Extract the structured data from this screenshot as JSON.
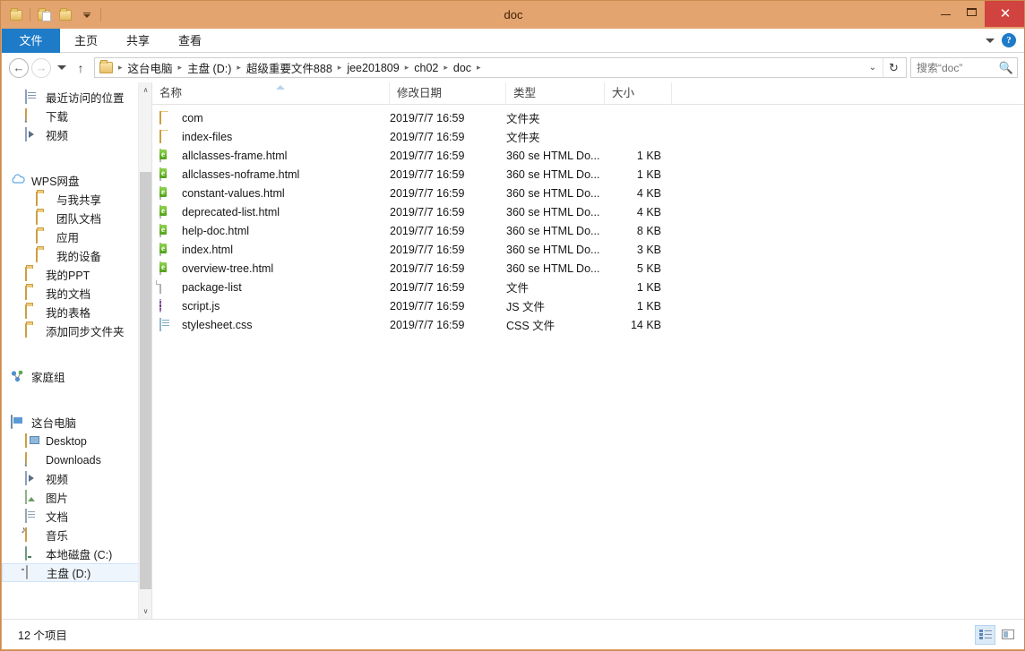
{
  "window": {
    "title": "doc",
    "quick_access": [
      "folder-icon",
      "properties-icon",
      "new-folder-icon",
      "customize-dropdown"
    ],
    "controls": {
      "minimize": "—",
      "maximize": "❑",
      "close": "✕"
    },
    "accent_titlebar": "#e3a470",
    "close_button_color": "#d0433f"
  },
  "ribbon": {
    "tabs": [
      {
        "label": "文件",
        "active": true
      },
      {
        "label": "主页",
        "active": false
      },
      {
        "label": "共享",
        "active": false
      },
      {
        "label": "查看",
        "active": false
      }
    ],
    "collapse_label": "∨",
    "help_label": "?",
    "active_tab_color": "#1e7bc8"
  },
  "navigation": {
    "back_label": "←",
    "forward_label": "→",
    "recent_label": "▾",
    "up_label": "↑",
    "breadcrumbs": [
      "这台电脑",
      "主盘 (D:)",
      "超级重要文件888",
      "jee201809",
      "ch02",
      "doc"
    ],
    "separator": "▸",
    "dropdown_label": "∨",
    "refresh_label": "↻"
  },
  "search": {
    "value": "",
    "placeholder": "搜索“doc”",
    "icon": "search-icon"
  },
  "sidebar": {
    "groups": [
      {
        "items": [
          {
            "label": "最近访问的位置",
            "icon": "recent-places-icon",
            "indent": 1
          },
          {
            "label": "下载",
            "icon": "downloads-icon",
            "indent": 1
          },
          {
            "label": "视频",
            "icon": "videos-icon",
            "indent": 1
          }
        ]
      },
      {
        "header": {
          "label": "WPS网盘",
          "icon": "cloud-icon",
          "indent": 0
        },
        "items": [
          {
            "label": "与我共享",
            "icon": "folder-icon",
            "indent": 2
          },
          {
            "label": "团队文档",
            "icon": "folder-icon",
            "indent": 2
          },
          {
            "label": "应用",
            "icon": "folder-icon",
            "indent": 2
          },
          {
            "label": "我的设备",
            "icon": "folder-icon",
            "indent": 2
          },
          {
            "label": "我的PPT",
            "icon": "folder-icon",
            "indent": 1
          },
          {
            "label": "我的文档",
            "icon": "folder-icon",
            "indent": 1
          },
          {
            "label": "我的表格",
            "icon": "folder-icon",
            "indent": 1
          },
          {
            "label": "添加同步文件夹",
            "icon": "folder-icon",
            "indent": 1
          }
        ]
      },
      {
        "header": {
          "label": "家庭组",
          "icon": "homegroup-icon",
          "indent": 0
        },
        "items": []
      },
      {
        "header": {
          "label": "这台电脑",
          "icon": "this-pc-icon",
          "indent": 0
        },
        "items": [
          {
            "label": "Desktop",
            "icon": "desktop-icon",
            "indent": 1
          },
          {
            "label": "Downloads",
            "icon": "downloads-icon",
            "indent": 1
          },
          {
            "label": "视频",
            "icon": "videos-icon",
            "indent": 1
          },
          {
            "label": "图片",
            "icon": "pictures-icon",
            "indent": 1
          },
          {
            "label": "文档",
            "icon": "documents-icon",
            "indent": 1
          },
          {
            "label": "音乐",
            "icon": "music-icon",
            "indent": 1
          },
          {
            "label": "本地磁盘 (C:)",
            "icon": "hard-drive-icon",
            "indent": 1
          },
          {
            "label": "主盘 (D:)",
            "icon": "removable-drive-icon",
            "indent": 1,
            "selected": true
          }
        ]
      }
    ],
    "scroll_up_label": "∧",
    "scroll_down_label": "∨"
  },
  "filelist": {
    "columns": [
      {
        "key": "name",
        "label": "名称",
        "sorted": "asc"
      },
      {
        "key": "date",
        "label": "修改日期"
      },
      {
        "key": "type",
        "label": "类型"
      },
      {
        "key": "size",
        "label": "大小"
      }
    ],
    "rows": [
      {
        "name": "com",
        "date": "2019/7/7 16:59",
        "type": "文件夹",
        "size": "",
        "icon": "folder-icon"
      },
      {
        "name": "index-files",
        "date": "2019/7/7 16:59",
        "type": "文件夹",
        "size": "",
        "icon": "folder-icon"
      },
      {
        "name": "allclasses-frame.html",
        "date": "2019/7/7 16:59",
        "type": "360 se HTML Do...",
        "size": "1 KB",
        "icon": "html-file-icon"
      },
      {
        "name": "allclasses-noframe.html",
        "date": "2019/7/7 16:59",
        "type": "360 se HTML Do...",
        "size": "1 KB",
        "icon": "html-file-icon"
      },
      {
        "name": "constant-values.html",
        "date": "2019/7/7 16:59",
        "type": "360 se HTML Do...",
        "size": "4 KB",
        "icon": "html-file-icon"
      },
      {
        "name": "deprecated-list.html",
        "date": "2019/7/7 16:59",
        "type": "360 se HTML Do...",
        "size": "4 KB",
        "icon": "html-file-icon"
      },
      {
        "name": "help-doc.html",
        "date": "2019/7/7 16:59",
        "type": "360 se HTML Do...",
        "size": "8 KB",
        "icon": "html-file-icon"
      },
      {
        "name": "index.html",
        "date": "2019/7/7 16:59",
        "type": "360 se HTML Do...",
        "size": "3 KB",
        "icon": "html-file-icon"
      },
      {
        "name": "overview-tree.html",
        "date": "2019/7/7 16:59",
        "type": "360 se HTML Do...",
        "size": "5 KB",
        "icon": "html-file-icon"
      },
      {
        "name": "package-list",
        "date": "2019/7/7 16:59",
        "type": "文件",
        "size": "1 KB",
        "icon": "generic-file-icon"
      },
      {
        "name": "script.js",
        "date": "2019/7/7 16:59",
        "type": "JS 文件",
        "size": "1 KB",
        "icon": "js-file-icon"
      },
      {
        "name": "stylesheet.css",
        "date": "2019/7/7 16:59",
        "type": "CSS 文件",
        "size": "14 KB",
        "icon": "css-file-icon"
      }
    ]
  },
  "statusbar": {
    "item_count": "12 个项目",
    "views": [
      {
        "name": "details-view",
        "active": true
      },
      {
        "name": "large-icons-view",
        "active": false
      }
    ]
  }
}
